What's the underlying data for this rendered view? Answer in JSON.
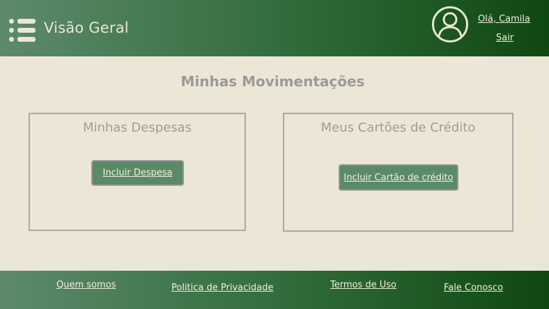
{
  "header": {
    "title": "Visão Geral",
    "greeting": "Olá, Camila",
    "logout": "Sair",
    "menu_icon": "hamburger-menu-icon",
    "avatar_icon": "user-avatar-icon"
  },
  "main": {
    "title": "Minhas Movimentações",
    "cards": [
      {
        "title": "Minhas Despesas",
        "button": "Incluir Despesa"
      },
      {
        "title": "Meus Cartões de Crédito",
        "button": "Incluir Cartão de crédito"
      }
    ]
  },
  "footer": {
    "links": [
      "Quem somos",
      "Politica de Privacidade",
      "Termos de Uso",
      "Fale Conosco"
    ]
  },
  "colors": {
    "header_gradient_start": "#5d8a6b",
    "header_gradient_end": "#0f4710",
    "background": "#ebe6d6",
    "button": "#5a8a68",
    "muted_text": "#9a9a98"
  }
}
